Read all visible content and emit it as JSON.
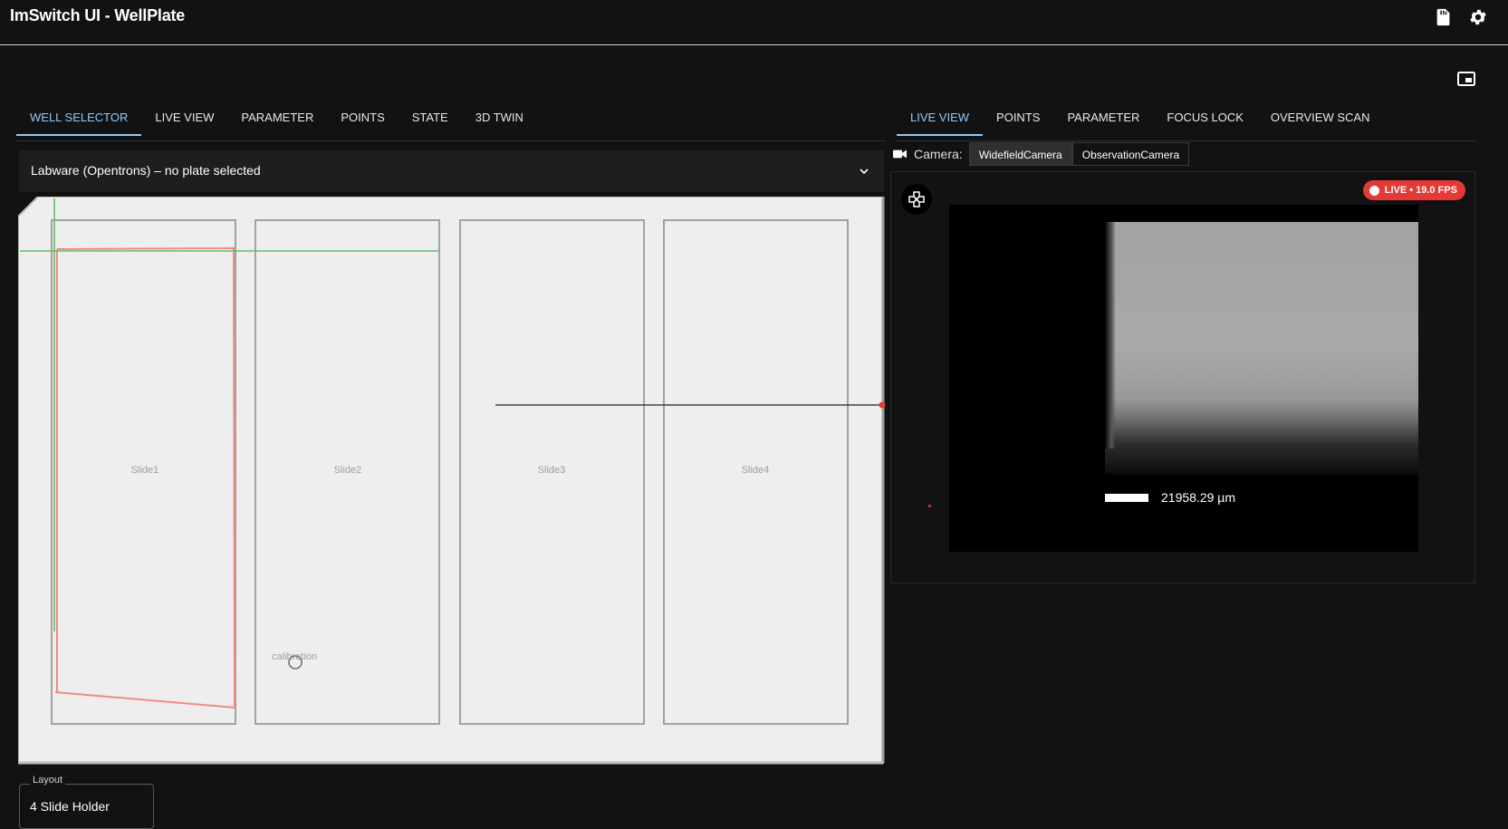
{
  "app": {
    "title": "ImSwitch UI - WellPlate"
  },
  "left_tabs": [
    {
      "label": "WELL SELECTOR",
      "active": true
    },
    {
      "label": "LIVE VIEW",
      "active": false
    },
    {
      "label": "PARAMETER",
      "active": false
    },
    {
      "label": "POINTS",
      "active": false
    },
    {
      "label": "STATE",
      "active": false
    },
    {
      "label": "3D TWIN",
      "active": false
    }
  ],
  "right_tabs": [
    {
      "label": "LIVE VIEW",
      "active": true
    },
    {
      "label": "POINTS",
      "active": false
    },
    {
      "label": "PARAMETER",
      "active": false
    },
    {
      "label": "FOCUS LOCK",
      "active": false
    },
    {
      "label": "OVERVIEW SCAN",
      "active": false
    }
  ],
  "labware": {
    "label": "Labware (Opentrons) – no plate selected"
  },
  "plate": {
    "slides": [
      "Slide1",
      "Slide2",
      "Slide3",
      "Slide4"
    ],
    "calibration_label": "calibration"
  },
  "layout": {
    "label": "Layout",
    "value": "4 Slide Holder"
  },
  "camera": {
    "label": "Camera:",
    "options": [
      "WidefieldCamera",
      "ObservationCamera"
    ],
    "selected": "WidefieldCamera"
  },
  "live": {
    "badge": "LIVE • 19.0 FPS",
    "scale_text": "21958.29 µm"
  },
  "colors": {
    "accent": "#90caf9",
    "live_badge": "#e53935",
    "overlay_red": "#f28b82",
    "overlay_green": "#66bb6a"
  },
  "icons": [
    "sd-card-icon",
    "settings-icon",
    "picture-in-picture-icon",
    "chevron-down-icon",
    "videocam-icon",
    "gamepad-icon"
  ]
}
